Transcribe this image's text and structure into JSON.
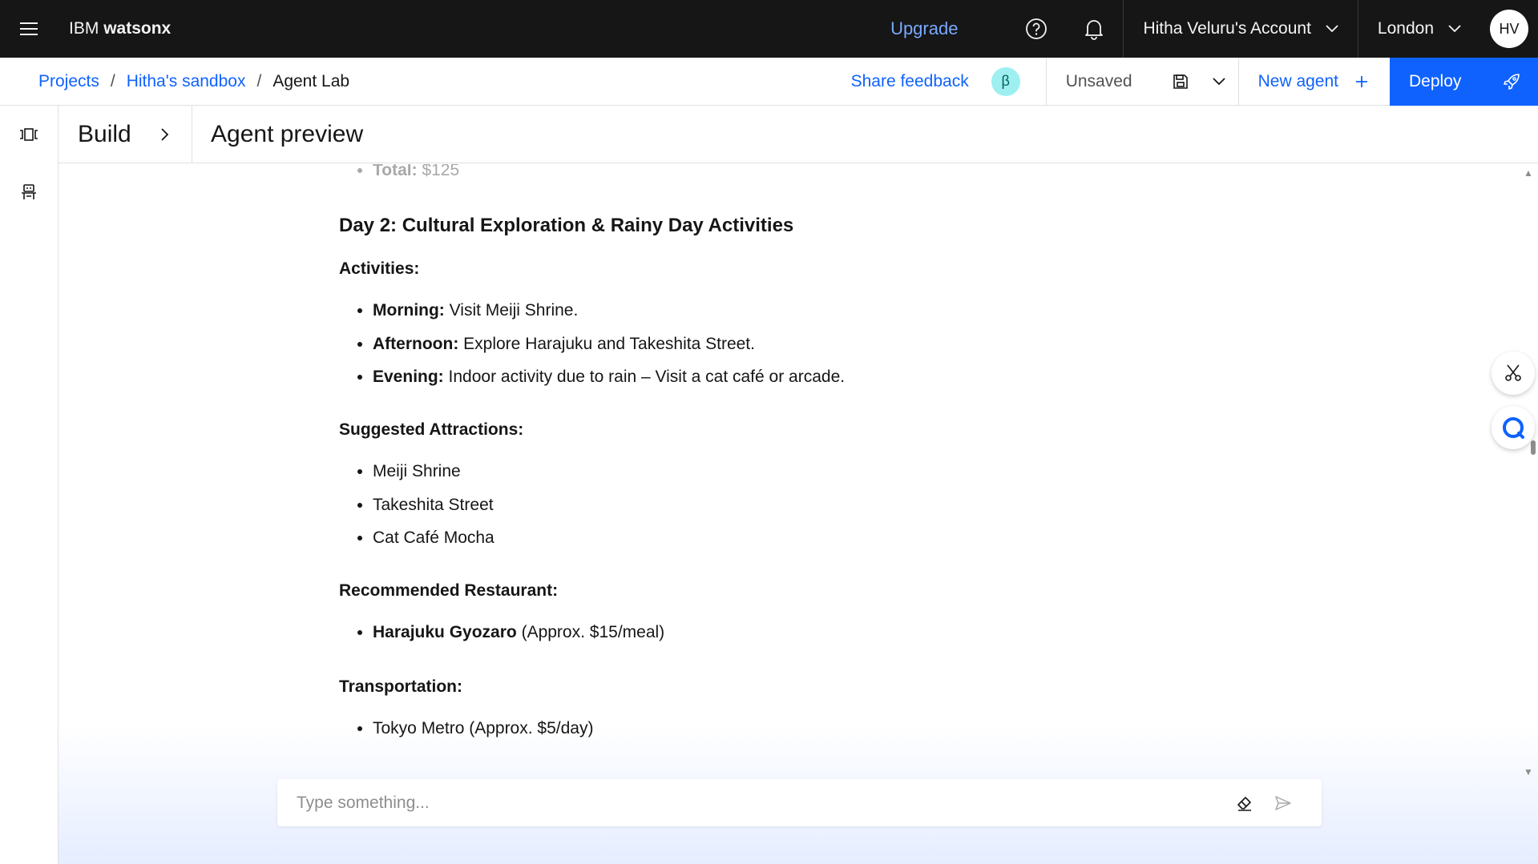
{
  "header": {
    "brand_prefix": "IBM",
    "brand_product": "watsonx",
    "upgrade_label": "Upgrade",
    "account_label": "Hitha Veluru's Account",
    "region_label": "London",
    "avatar_initials": "HV"
  },
  "subbar": {
    "breadcrumbs": [
      "Projects",
      "Hitha's sandbox",
      "Agent Lab"
    ],
    "breadcrumb_separator": "/",
    "share_feedback": "Share feedback",
    "beta_badge": "β",
    "status": "Unsaved",
    "new_agent_label": "New agent",
    "deploy_label": "Deploy"
  },
  "panel": {
    "build_label": "Build",
    "title": "Agent preview"
  },
  "message": {
    "prev_item_label": "Total:",
    "prev_item_value": "$125",
    "day_title": "Day 2: Cultural Exploration & Rainy Day Activities",
    "activities_heading": "Activities:",
    "activities": [
      {
        "label": "Morning:",
        "text": "Visit Meiji Shrine."
      },
      {
        "label": "Afternoon:",
        "text": "Explore Harajuku and Takeshita Street."
      },
      {
        "label": "Evening:",
        "text": "Indoor activity due to rain – Visit a cat café or arcade."
      }
    ],
    "attractions_heading": "Suggested Attractions:",
    "attractions": [
      "Meiji Shrine",
      "Takeshita Street",
      "Cat Café Mocha"
    ],
    "restaurant_heading": "Recommended Restaurant:",
    "restaurant": {
      "name": "Harajuku Gyozaro",
      "detail": "(Approx. $15/meal)"
    },
    "transport_heading": "Transportation:",
    "transport": [
      "Tokyo Metro (Approx. $5/day)"
    ]
  },
  "input": {
    "placeholder": "Type something...",
    "value": ""
  },
  "colors": {
    "header_bg": "#161616",
    "accent_blue": "#0f62fe",
    "link_blue_dark": "#78a9ff",
    "beta_bg": "#9ef0f0"
  },
  "icons": {
    "menu": "hamburger-icon",
    "help": "help-icon",
    "notifications": "bell-icon",
    "save": "save-icon",
    "deploy": "rocket-icon",
    "rail_top": "carousel-icon",
    "rail_agent": "agent-icon",
    "clear": "eraser-icon",
    "send": "send-icon",
    "scissors": "scissors-icon",
    "assistant": "chat-icon"
  }
}
